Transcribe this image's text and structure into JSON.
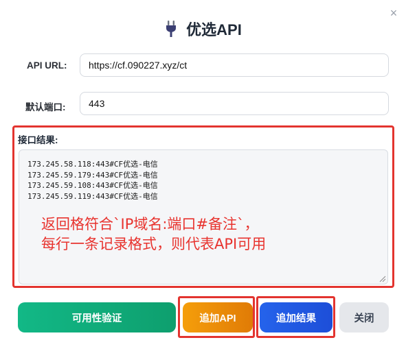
{
  "dialog": {
    "title": "优选API",
    "close_icon": "×"
  },
  "form": {
    "api_url_label": "API URL:",
    "api_url_value": "https://cf.090227.xyz/ct",
    "port_label": "默认端口:",
    "port_value": "443"
  },
  "result": {
    "label": "接口结果:",
    "lines": [
      "173.245.58.118:443#CF优选-电信",
      "173.245.59.179:443#CF优选-电信",
      "173.245.59.108:443#CF优选-电信",
      "173.245.59.119:443#CF优选-电信"
    ],
    "annotation_line1": "返回格符合`IP域名:端口#备注`，",
    "annotation_line2": "每行一条记录格式，则代表API可用"
  },
  "buttons": {
    "verify": "可用性验证",
    "add_api": "追加API",
    "add_result": "追加结果",
    "close": "关闭"
  },
  "colors": {
    "highlight": "#e3342f",
    "verify": "#12b886",
    "add_api": "#f59e0b",
    "add_result": "#2563eb",
    "close": "#e5e7eb"
  }
}
